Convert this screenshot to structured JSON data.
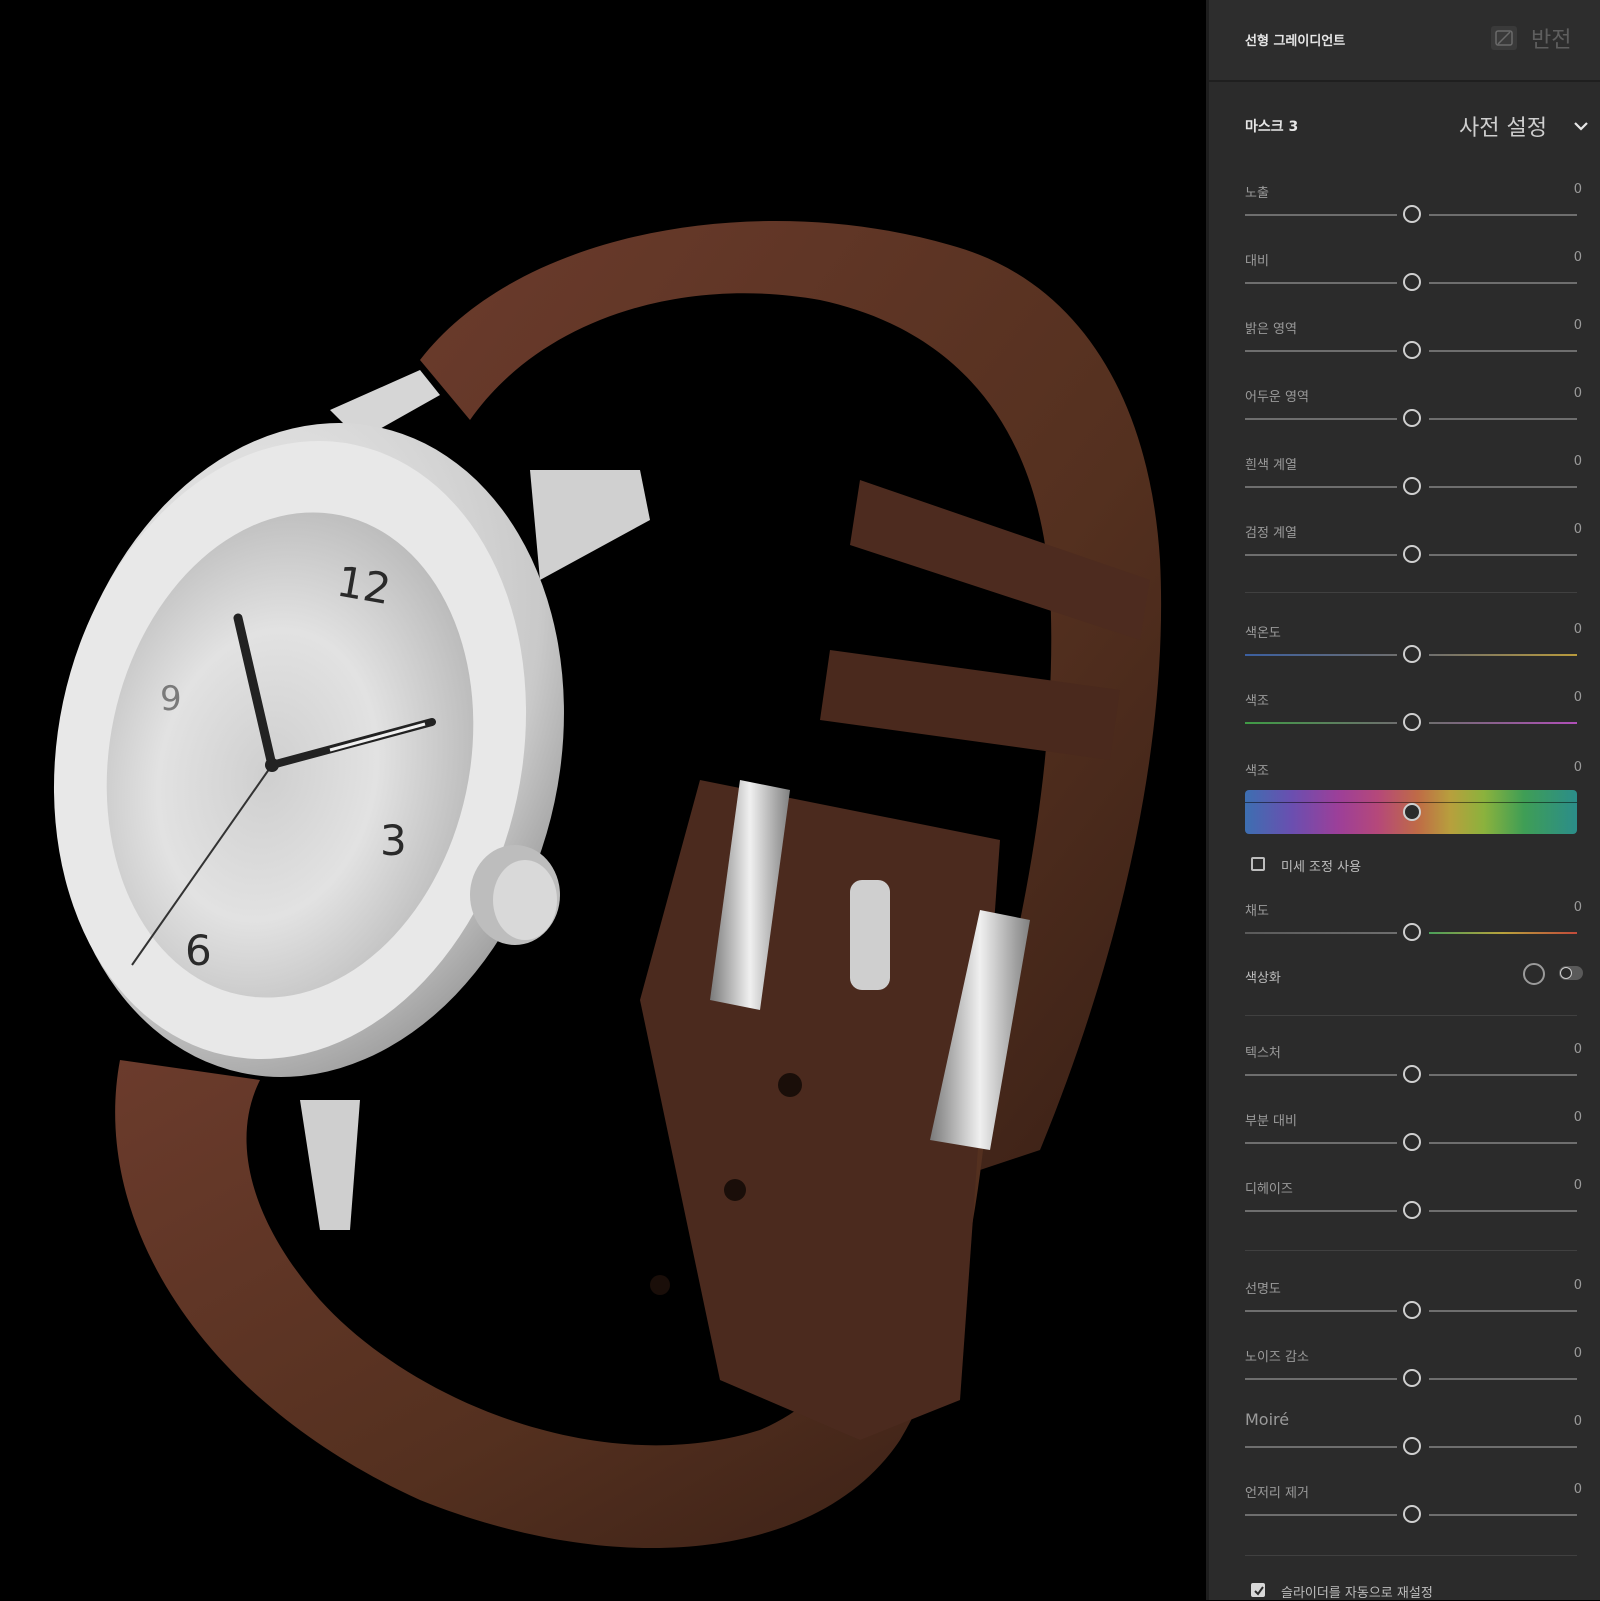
{
  "panel": {
    "header_title": "선형 그레이디언트",
    "invert_label": "반전",
    "mask_title": "마스크 3",
    "preset_label": "사전 설정",
    "groups": {
      "light": [
        {
          "label": "노출",
          "value": "0"
        },
        {
          "label": "대비",
          "value": "0"
        },
        {
          "label": "밝은 영역",
          "value": "0"
        },
        {
          "label": "어두운 영역",
          "value": "0"
        },
        {
          "label": "흰색 계열",
          "value": "0"
        },
        {
          "label": "검정 계열",
          "value": "0"
        }
      ],
      "color": {
        "temperature": {
          "label": "색온도",
          "value": "0"
        },
        "tint": {
          "label": "색조",
          "value": "0"
        },
        "hue": {
          "label": "색조",
          "value": "0"
        },
        "fine_tune_label": "미세 조정 사용",
        "saturation": {
          "label": "채도",
          "value": "0"
        },
        "colorize_label": "색상화"
      },
      "effects": [
        {
          "label": "텍스처",
          "value": "0"
        },
        {
          "label": "부분 대비",
          "value": "0"
        },
        {
          "label": "디헤이즈",
          "value": "0"
        }
      ],
      "detail": [
        {
          "label": "선명도",
          "value": "0"
        },
        {
          "label": "노이즈 감소",
          "value": "0"
        },
        {
          "label": "Moiré",
          "value": "0"
        },
        {
          "label": "언저리 제거",
          "value": "0"
        }
      ]
    },
    "auto_reset_label": "슬라이더를 자동으로 재설정",
    "auto_reset_checked": true,
    "fine_tune_checked": false
  },
  "photo": {
    "dial_numbers": [
      "12",
      "3",
      "6",
      "9"
    ]
  },
  "colors": {
    "panel_bg": "#2b2b2b",
    "strap": "#5a3226",
    "steel": "#d9d9d9"
  }
}
